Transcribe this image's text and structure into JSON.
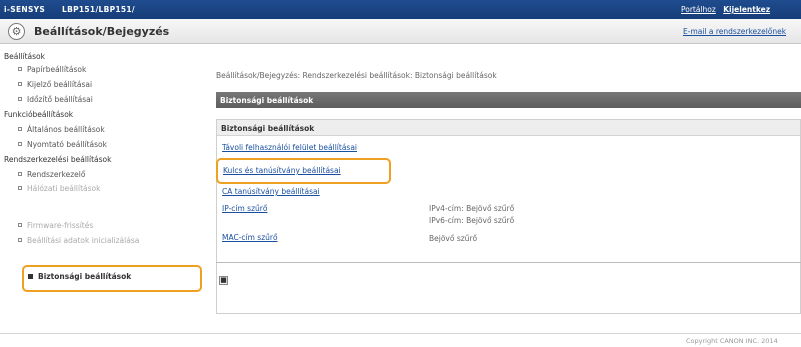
{
  "topbar": {
    "brand": "i-SENSYS",
    "model": "LBP151/LBP151/",
    "link_portal": "Portálhoz",
    "link_logout": "Kijelentkez"
  },
  "header": {
    "title": "Beállítások/Bejegyzés",
    "link_email": "E-mail a rendszerkezelőnek"
  },
  "sidebar": {
    "section1": "Beállítások",
    "items1": [
      "Papírbeállítások",
      "Kijelző beállításai",
      "Időzítő beállításai"
    ],
    "section2": "Funkcióbeállítások",
    "items2": [
      "Általános beállítások",
      "Nyomtató beállítások"
    ],
    "section3": "Rendszerkezelési beállítások",
    "items3": [
      "Rendszerkezelő",
      "Hálózati beállítások"
    ],
    "selected": "Biztonsági beállítások",
    "items4": [
      "Firmware-frissítés",
      "Beállítási adatok inicializálása"
    ]
  },
  "main": {
    "breadcrumb": "Beállítások/Bejegyzés: Rendszerkezelési beállítások: Biztonsági beállítások",
    "section_title": "Biztonsági beállítások",
    "panel_title": "Biztonsági beállítások",
    "links": {
      "remote_ui": "Távoli felhasználói felület beállításai",
      "keys": "Kulcs és tanúsítvány beállításai",
      "ca": "CA tanúsítvány beállításai",
      "ip_filter": "IP-cím szűrő",
      "mac_filter": "MAC-cím szűrő"
    },
    "values": {
      "ipv4": "IPv4-cím: Bejövő szűrő",
      "ipv6": "IPv6-cím: Bejövő szűrő",
      "mac": "Bejövő szűrő"
    },
    "expand_glyph": "■"
  },
  "footer": {
    "copyright": "Copyright CANON INC. 2014"
  }
}
